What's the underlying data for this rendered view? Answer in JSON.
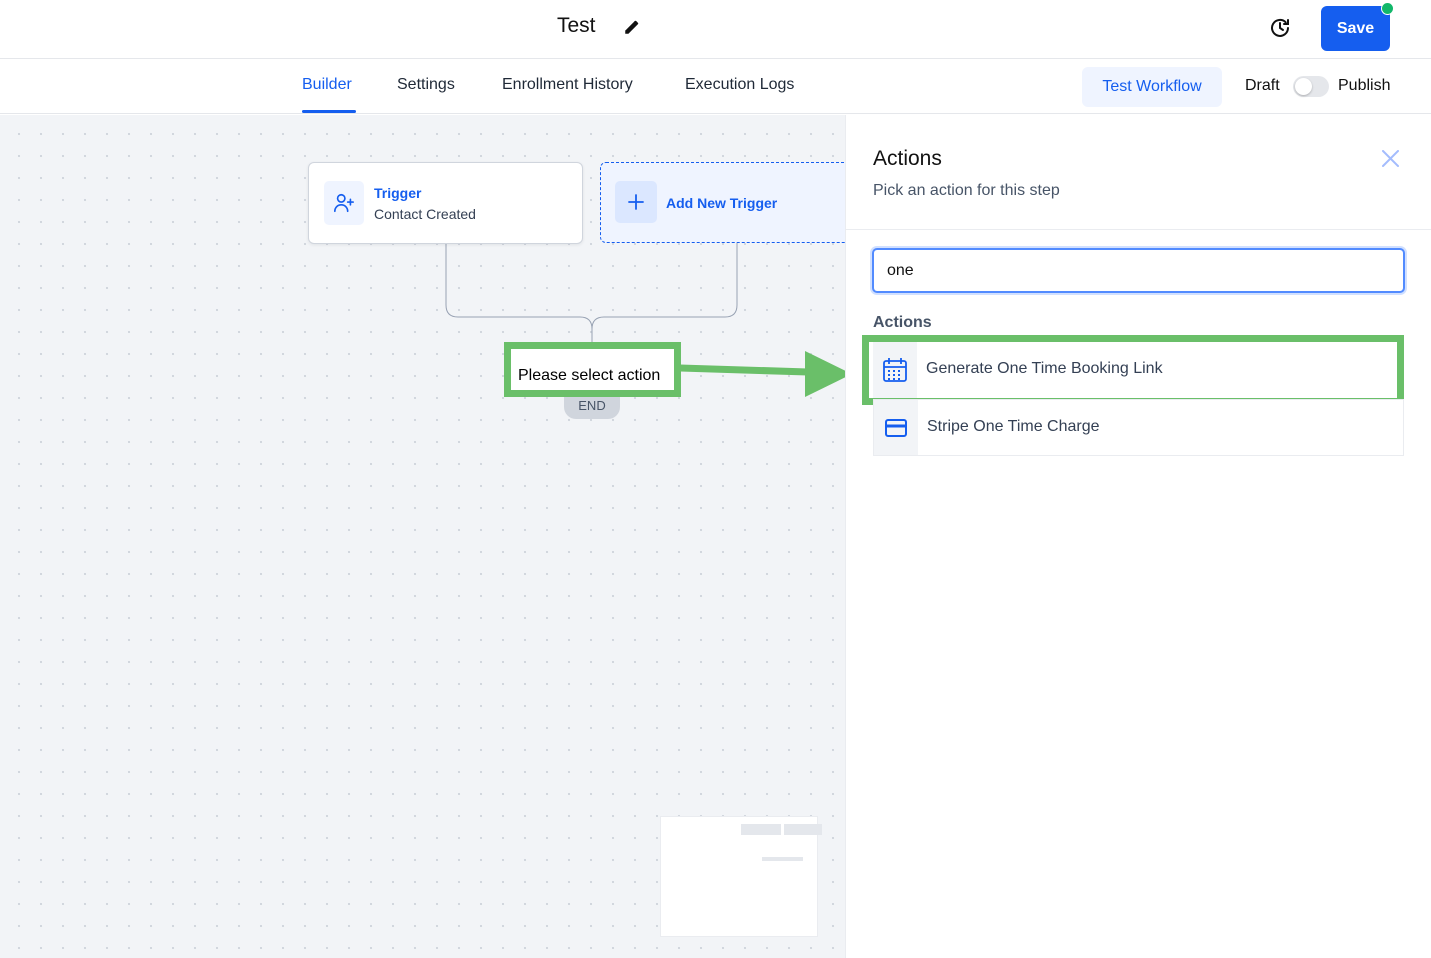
{
  "header": {
    "title": "Test",
    "save_label": "Save"
  },
  "tabs": [
    {
      "label": "Builder",
      "active": true
    },
    {
      "label": "Settings",
      "active": false
    },
    {
      "label": "Enrollment History",
      "active": false
    },
    {
      "label": "Execution Logs",
      "active": false
    }
  ],
  "toolbar": {
    "test_label": "Test Workflow",
    "draft_label": "Draft",
    "publish_label": "Publish",
    "published": false
  },
  "canvas": {
    "trigger": {
      "label": "Trigger",
      "description": "Contact Created"
    },
    "add_trigger_label": "Add New Trigger",
    "select_action_label": "Please select action",
    "end_label": "END"
  },
  "panel": {
    "title": "Actions",
    "subtitle": "Pick an action for this step",
    "search_value": "one",
    "section_label": "Actions",
    "items": [
      {
        "label": "Generate One Time Booking Link",
        "icon": "calendar-icon"
      },
      {
        "label": "Stripe One Time Charge",
        "icon": "credit-card-icon"
      }
    ]
  },
  "colors": {
    "primary": "#155eef",
    "highlight": "#6abf69",
    "status_dot": "#12b76a"
  }
}
